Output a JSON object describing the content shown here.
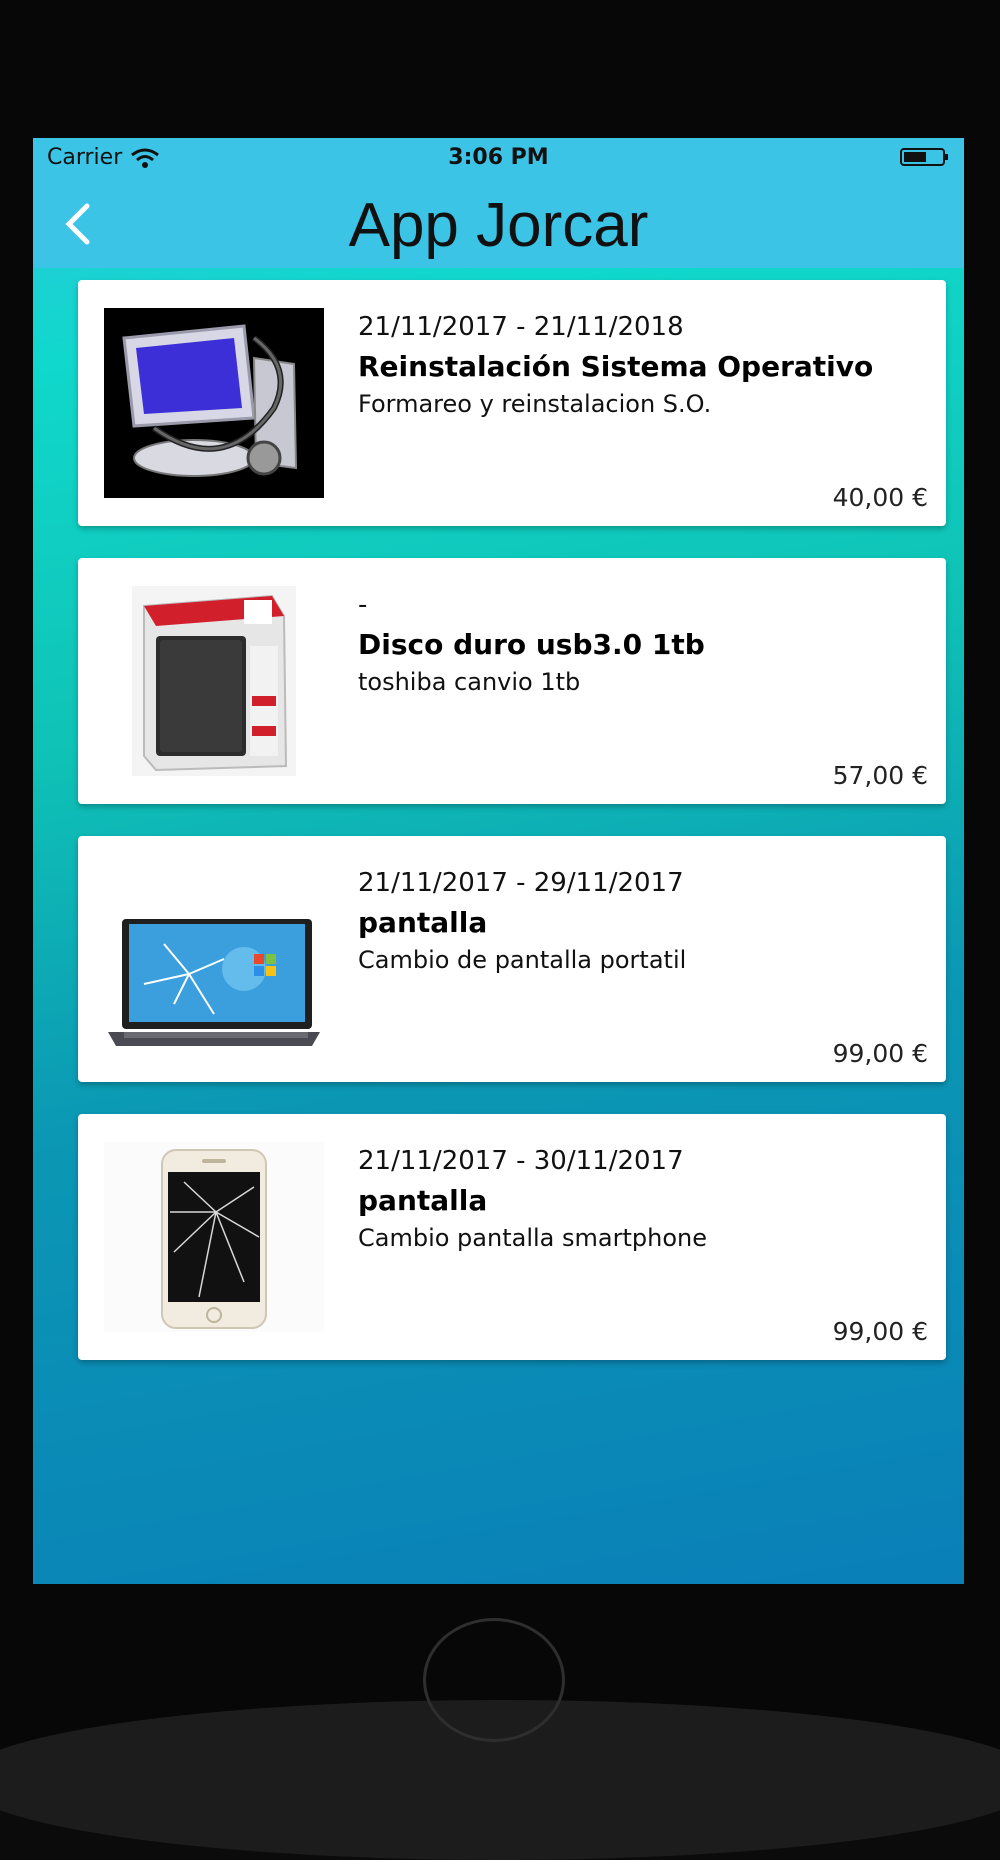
{
  "status_bar": {
    "carrier": "Carrier",
    "time": "3:06 PM"
  },
  "nav": {
    "title": "App Jorcar"
  },
  "items": [
    {
      "date_range": "21/11/2017 - 21/11/2018",
      "title": "Reinstalación Sistema Operativo",
      "description": "Formareo y reinstalacion S.O.",
      "price": "40,00 €",
      "image": "computer-stethoscope-image"
    },
    {
      "date_range": "-",
      "title": "Disco duro usb3.0 1tb",
      "description": "toshiba canvio 1tb",
      "price": "57,00 €",
      "image": "external-hard-drive-box-image"
    },
    {
      "date_range": "21/11/2017 - 29/11/2017",
      "title": "pantalla",
      "description": "Cambio de pantalla portatil",
      "price": "99,00 €",
      "image": "broken-laptop-screen-image"
    },
    {
      "date_range": "21/11/2017 - 30/11/2017",
      "title": "pantalla",
      "description": "Cambio pantalla smartphone",
      "price": "99,00 €",
      "image": "broken-smartphone-image"
    }
  ],
  "colors": {
    "nav_bar": "#3bc4e6",
    "card_background": "#ffffff",
    "gradient_top": "#10d8cc",
    "gradient_bottom": "#0a7fb8"
  }
}
